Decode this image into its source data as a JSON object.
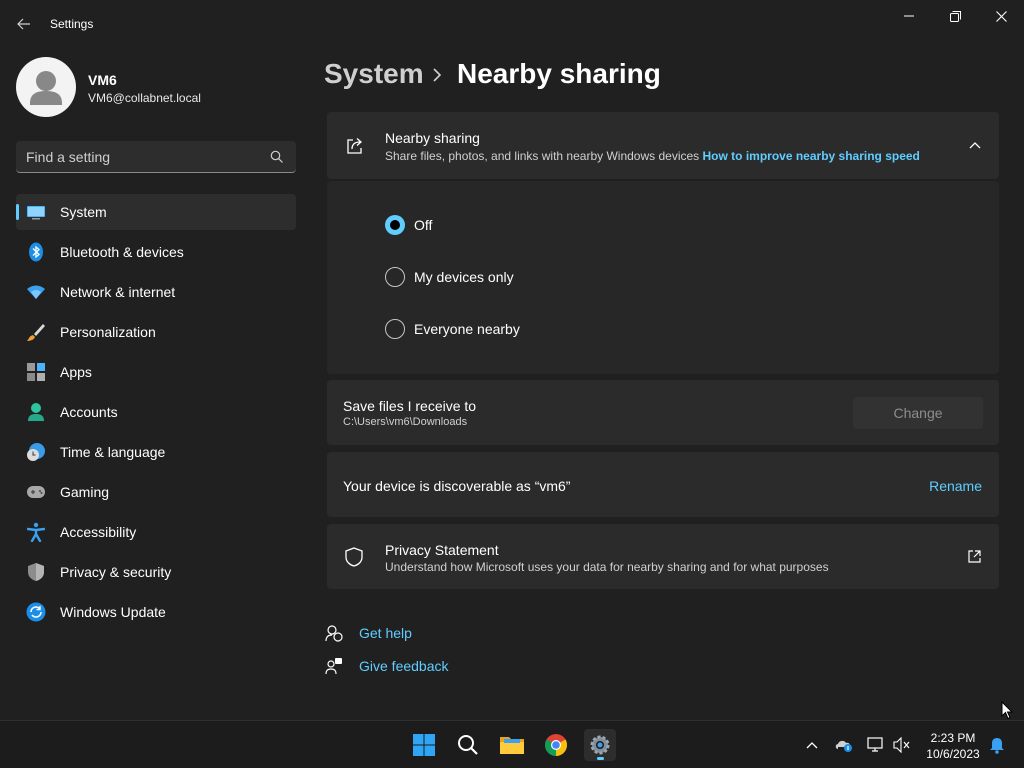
{
  "window": {
    "app_title": "Settings"
  },
  "user": {
    "name": "VM6",
    "email": "VM6@collabnet.local"
  },
  "search": {
    "placeholder": "Find a setting"
  },
  "sidebar": {
    "items": [
      {
        "label": "System",
        "icon": "monitor-icon",
        "active": true
      },
      {
        "label": "Bluetooth & devices",
        "icon": "bluetooth-icon"
      },
      {
        "label": "Network & internet",
        "icon": "wifi-icon"
      },
      {
        "label": "Personalization",
        "icon": "paintbrush-icon"
      },
      {
        "label": "Apps",
        "icon": "apps-icon"
      },
      {
        "label": "Accounts",
        "icon": "person-icon"
      },
      {
        "label": "Time & language",
        "icon": "globe-clock-icon"
      },
      {
        "label": "Gaming",
        "icon": "gamepad-icon"
      },
      {
        "label": "Accessibility",
        "icon": "accessibility-icon"
      },
      {
        "label": "Privacy & security",
        "icon": "shield-icon"
      },
      {
        "label": "Windows Update",
        "icon": "update-icon"
      }
    ]
  },
  "header": {
    "parent": "System",
    "current": "Nearby sharing"
  },
  "nearby_sharing": {
    "title": "Nearby sharing",
    "description": "Share files, photos, and links with nearby Windows devices",
    "help_link": "How to improve nearby sharing speed",
    "options": [
      {
        "label": "Off",
        "selected": true
      },
      {
        "label": "My devices only",
        "selected": false
      },
      {
        "label": "Everyone nearby",
        "selected": false
      }
    ]
  },
  "save_files": {
    "title": "Save files I receive to",
    "path": "C:\\Users\\vm6\\Downloads",
    "button": "Change"
  },
  "discoverable": {
    "text": "Your device is discoverable as “vm6”",
    "action": "Rename"
  },
  "privacy": {
    "title": "Privacy Statement",
    "description": "Understand how Microsoft uses your data for nearby sharing and for what purposes"
  },
  "help": {
    "get_help": "Get help",
    "give_feedback": "Give feedback"
  },
  "taskbar": {
    "time": "2:23 PM",
    "date": "10/6/2023"
  },
  "colors": {
    "accent": "#60cdff",
    "background": "#202020",
    "card": "#2b2b2b"
  }
}
